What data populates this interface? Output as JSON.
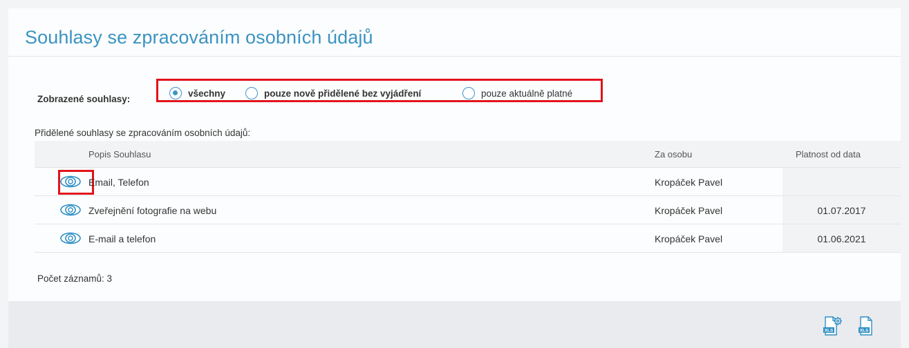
{
  "page": {
    "title": "Souhlasy se zpracováním osobních údajů"
  },
  "filter": {
    "label": "Zobrazené souhlasy:",
    "options": [
      {
        "label": "všechny",
        "checked": true
      },
      {
        "label": "pouze nově přidělené bez vyjádření",
        "checked": false
      },
      {
        "label": "pouze aktuálně platné",
        "checked": false
      }
    ]
  },
  "grid": {
    "caption": "Přidělené souhlasy se zpracováním osobních údajů:",
    "columns": [
      "Popis Souhlasu",
      "Za osobu",
      "Platnost od data"
    ],
    "rows": [
      {
        "description": "Email, Telefon",
        "person": "Kropáček Pavel",
        "date": ""
      },
      {
        "description": "Zveřejnění fotografie na webu",
        "person": "Kropáček Pavel",
        "date": "01.07.2017"
      },
      {
        "description": "E-mail a telefon",
        "person": "Kropáček Pavel",
        "date": "01.06.2021"
      }
    ],
    "row_icon": "eye-icon",
    "record_count": "Počet záznamů: 3"
  },
  "footer": {
    "buttons": [
      {
        "icon": "xls-export-settings-icon",
        "text": "XLS"
      },
      {
        "icon": "xls-export-icon",
        "text": "XLS"
      }
    ]
  },
  "colors": {
    "accent": "#3b93c2",
    "highlight": "#e3121b"
  }
}
